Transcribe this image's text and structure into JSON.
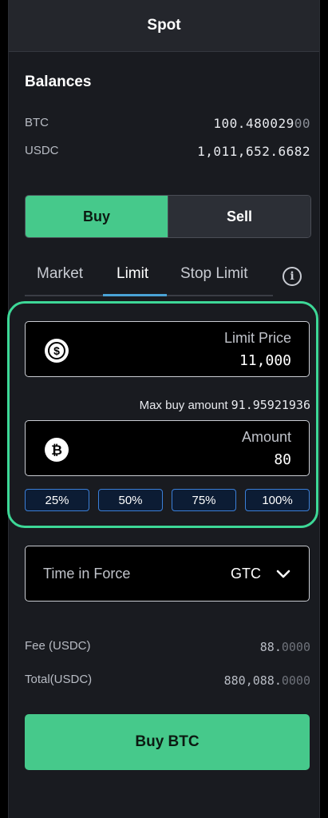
{
  "header": {
    "title": "Spot"
  },
  "balances": {
    "title": "Balances",
    "rows": [
      {
        "asset": "BTC",
        "value_main": "100.480029",
        "value_dim": "00"
      },
      {
        "asset": "USDC",
        "value_main": "1,011,652.6682",
        "value_dim": ""
      }
    ]
  },
  "side_toggle": {
    "buy": "Buy",
    "sell": "Sell",
    "selected": "Buy"
  },
  "order_tabs": {
    "items": [
      "Market",
      "Limit",
      "Stop Limit"
    ],
    "active": "Limit",
    "info_icon": "info-icon"
  },
  "limit_price": {
    "label": "Limit Price",
    "value": "11,000",
    "icon": "usdc-coin-icon"
  },
  "max_buy": {
    "label": "Max buy amount",
    "value": "91.95921936"
  },
  "amount": {
    "label": "Amount",
    "value": "80",
    "icon": "bitcoin-coin-icon"
  },
  "percent_buttons": [
    "25%",
    "50%",
    "75%",
    "100%"
  ],
  "time_in_force": {
    "label": "Time in Force",
    "value": "GTC",
    "icon": "chevron-down-icon"
  },
  "fees": {
    "fee_label": "Fee (USDC)",
    "fee_main": "88.",
    "fee_dim": "0000",
    "total_label": "Total(USDC)",
    "total_main": "880,088.",
    "total_dim": "0000"
  },
  "submit": {
    "label": "Buy BTC"
  },
  "colors": {
    "accent_green": "#46c98b",
    "highlight_border": "#3dd897",
    "tab_underline": "#4aa3d6",
    "pct_border": "#3b7fd8"
  }
}
